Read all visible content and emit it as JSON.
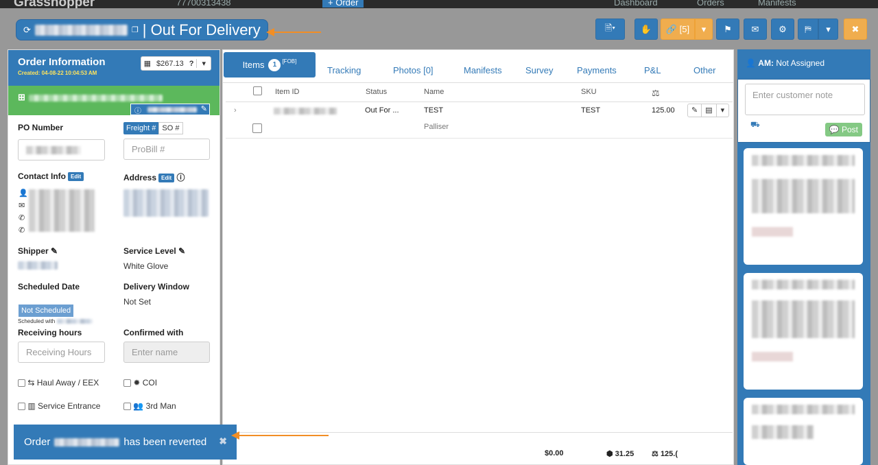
{
  "topnav": {
    "brand": "Grasshopper",
    "phone": "77700313438",
    "order_btn": "+ Order",
    "dashboard": "Dashboard",
    "orders": "Orders",
    "manifests": "Manifests"
  },
  "title": {
    "status": "| Out For Delivery"
  },
  "toolbar": {
    "links_label": "[5]"
  },
  "order_info": {
    "title": "Order Information",
    "created": "Created: 04-08-22 10:04:53 AM",
    "price": "$267.13"
  },
  "fields": {
    "po_label": "PO Number",
    "freight_tab": "Freight #",
    "so_tab": "SO #",
    "probill_placeholder": "ProBill #",
    "contact_label": "Contact Info",
    "address_label": "Address",
    "edit": "Edit",
    "shipper_label": "Shipper",
    "service_level_label": "Service Level",
    "service_level_value": "White Glove",
    "scheduled_date_label": "Scheduled Date",
    "scheduled_value": "Not Scheduled",
    "scheduled_with": "Scheduled with",
    "delivery_window_label": "Delivery Window",
    "delivery_window_value": "Not Set",
    "receiving_hours_label": "Receiving hours",
    "receiving_hours_placeholder": "Receiving Hours",
    "confirmed_with_label": "Confirmed with",
    "confirmed_with_placeholder": "Enter name",
    "haul_away": "Haul Away / EEX",
    "coi": "COI",
    "service_entrance": "Service Entrance",
    "third_man": "3rd Man"
  },
  "tabs": {
    "items": "Items",
    "items_count": "1",
    "items_tag": "[FOB]",
    "tracking": "Tracking",
    "photos": "Photos [0]",
    "manifests": "Manifests",
    "survey": "Survey",
    "payments": "Payments",
    "pl": "P&L",
    "other": "Other"
  },
  "table": {
    "headers": {
      "item_id": "Item ID",
      "status": "Status",
      "name": "Name",
      "sku": "SKU"
    },
    "row": {
      "status": "Out For ...",
      "name": "TEST",
      "sub": "Palliser",
      "sku": "TEST",
      "value": "125.00"
    }
  },
  "totals": {
    "price": "$0.00",
    "cube": "31.25",
    "weight": "125.("
  },
  "right": {
    "am_label": "AM:",
    "am_value": "Not Assigned",
    "note_placeholder": "Enter customer note",
    "post": "Post"
  },
  "toast": {
    "prefix": "Order",
    "suffix": "has been reverted"
  },
  "colors": {
    "primary": "#337ab7",
    "success": "#5cb85c",
    "warning": "#f0ad4e",
    "annotation": "#f28e25"
  }
}
